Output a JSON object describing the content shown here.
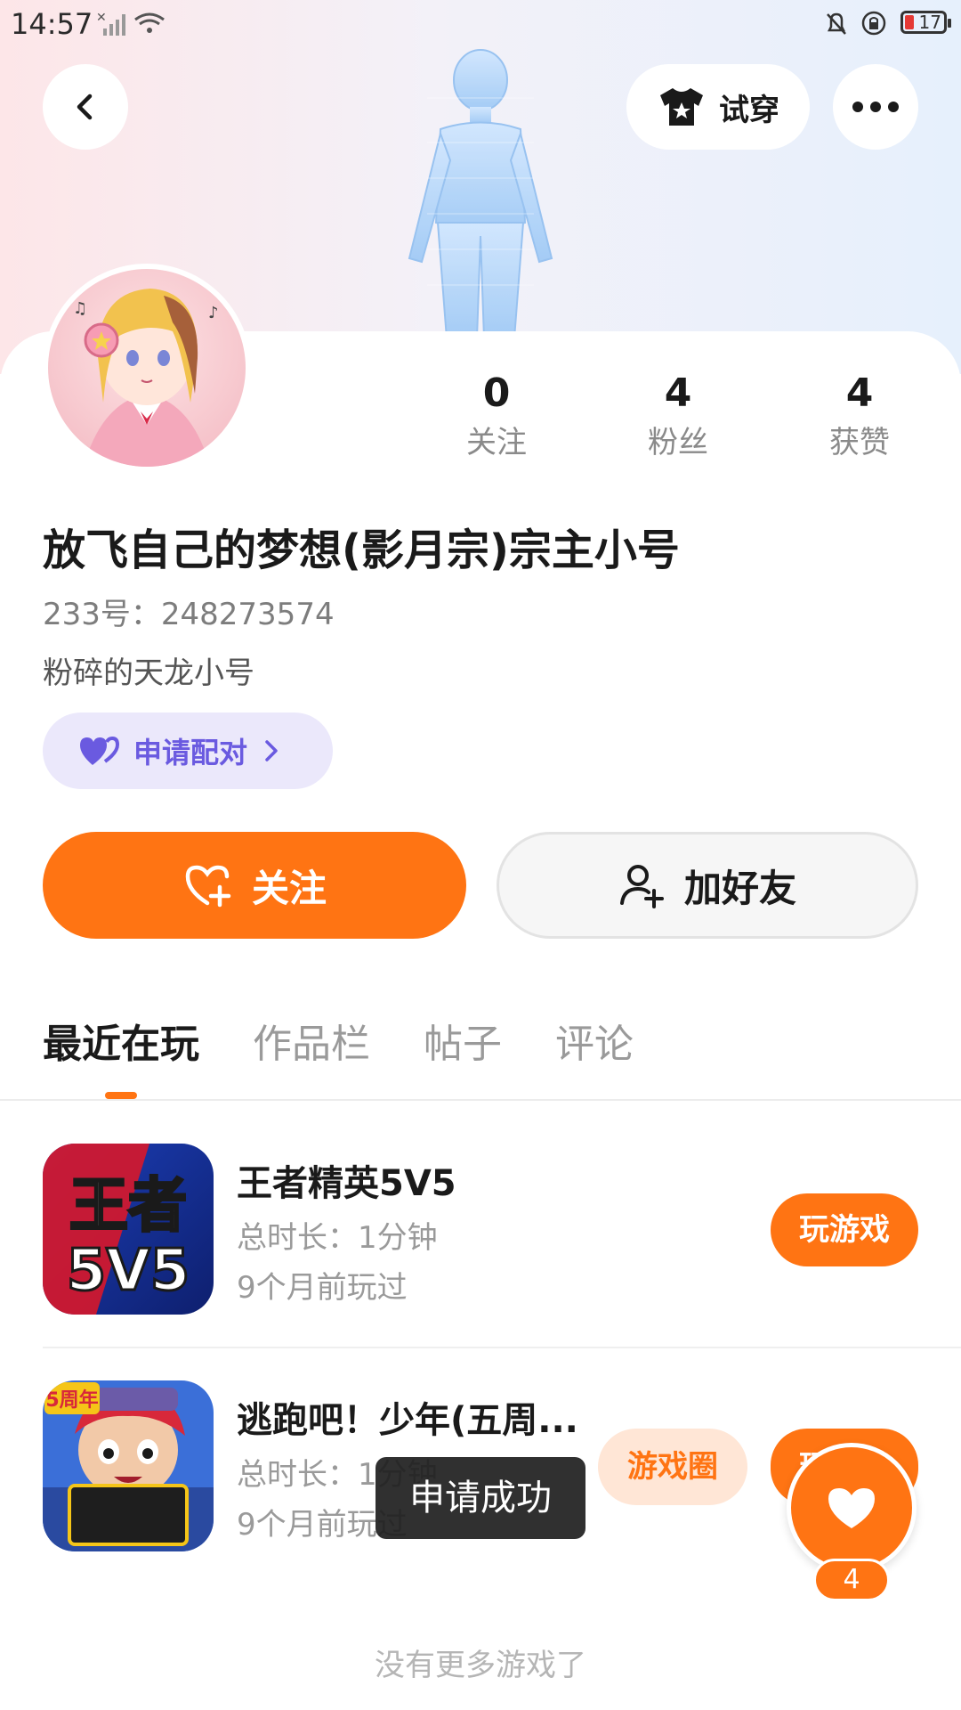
{
  "status_bar": {
    "time": "14:57",
    "battery": "17"
  },
  "header": {
    "try_on_label": "试穿"
  },
  "profile": {
    "nickname": "放飞自己的梦想(影月宗)宗主小号",
    "uid": "233号：248273574",
    "bio": "粉碎的天龙小号",
    "pair_label": "申请配对"
  },
  "stats": [
    {
      "value": "0",
      "label": "关注"
    },
    {
      "value": "4",
      "label": "粉丝"
    },
    {
      "value": "4",
      "label": "获赞"
    }
  ],
  "actions": {
    "follow_label": "关注",
    "add_friend_label": "加好友"
  },
  "tabs": [
    {
      "label": "最近在玩",
      "active": true
    },
    {
      "label": "作品栏",
      "active": false
    },
    {
      "label": "帖子",
      "active": false
    },
    {
      "label": "评论",
      "active": false
    }
  ],
  "games": [
    {
      "name": "王者精英5V5",
      "duration": "总时长：1分钟",
      "last_played": "9个月前玩过",
      "play_label": "玩游戏",
      "icon_text": "王者5V5"
    },
    {
      "name": "逃跑吧！少年(五周...",
      "duration": "总时长：1分钟",
      "last_played": "9个月前玩过",
      "circle_label": "游戏圈",
      "play_label": "玩游戏",
      "badge": "5周年"
    }
  ],
  "toast": "申请成功",
  "like": {
    "count": "4"
  },
  "footer": {
    "no_more": "没有更多游戏了"
  },
  "colors": {
    "accent": "#ff7413",
    "pair": "#6a5ae0"
  },
  "icons": [
    "back-icon",
    "shirt-icon",
    "more-icon",
    "purple-heart-icon",
    "chevron-right-icon",
    "heart-plus-icon",
    "user-plus-icon",
    "heart-icon"
  ]
}
